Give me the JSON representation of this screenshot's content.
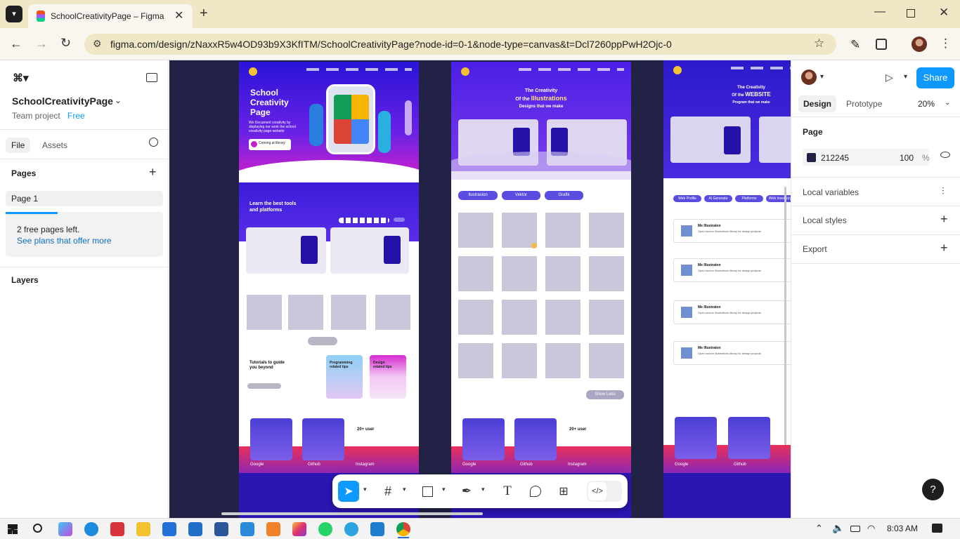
{
  "browser": {
    "tab_title": "SchoolCreativityPage – Figma",
    "url": "figma.com/design/zNaxxR5w4OD93b9X3KfITM/SchoolCreativityPage?node-id=0-1&node-type=canvas&t=Dcl7260ppPwH2Ojc-0"
  },
  "left_panel": {
    "file_name": "SchoolCreativityPage",
    "team": "Team project",
    "plan": "Free",
    "tabs": [
      "File",
      "Assets"
    ],
    "pages_heading": "Pages",
    "page_item": "Page 1",
    "free_pages_text": "2 free pages left.",
    "plans_link": "See plans that offer more",
    "layers_heading": "Layers"
  },
  "right_panel": {
    "share_label": "Share",
    "tabs": [
      "Design",
      "Prototype"
    ],
    "zoom": "20%",
    "page_heading": "Page",
    "bg_hex": "212245",
    "bg_opacity": "100",
    "percent": "%",
    "sections": [
      "Local variables",
      "Local styles",
      "Export"
    ]
  },
  "frame1": {
    "hero_title_1": "School",
    "hero_title_2": "Creativity",
    "hero_title_3": "Page",
    "hero_desc": "We Document creativity by displaying our work the school creativity page website",
    "coming_label": "Coming at library",
    "section_heading_1": "Learn the best tools",
    "section_heading_2": "and platforms",
    "tutorials_heading_1": "Tutorials to guide",
    "tutorials_heading_2": "you beyond",
    "prog_tip_1": "Programming",
    "prog_tip_2": "related tips",
    "design_tip_1": "Design",
    "design_tip_2": "related tips",
    "stats": "20+ user",
    "footer_links": [
      "Google",
      "Github",
      "Instagram"
    ]
  },
  "frame2": {
    "title_1": "The Creativity",
    "title_2a": "Of the ",
    "title_2b": "Illustrations",
    "title_3": "Designs that we make",
    "filters": [
      "Ilustrasion",
      "Vektor",
      "Grafik"
    ],
    "show_less": "Show Less",
    "stats": "20+ user",
    "footer_links": [
      "Google",
      "Github",
      "Instagram"
    ]
  },
  "frame3": {
    "title_1": "The Creativity",
    "title_2a": "Of the ",
    "title_2b": "WEBSITE",
    "title_3": "Program that we make",
    "filters": [
      "Web Profile",
      "AI Generate",
      "Platforms",
      "Web Inventory"
    ],
    "list_title": "Me Illustraton",
    "list_desc": "Open source illustrations library for design projects",
    "footer_links": [
      "Google",
      "Github"
    ]
  },
  "taskbar": {
    "time": "8:03 AM"
  },
  "colors": {
    "accent": "#0d99ff",
    "canvas_bg": "#212245",
    "hero_purple": "#4b21e8",
    "chip_purple": "#5b4ce0"
  }
}
